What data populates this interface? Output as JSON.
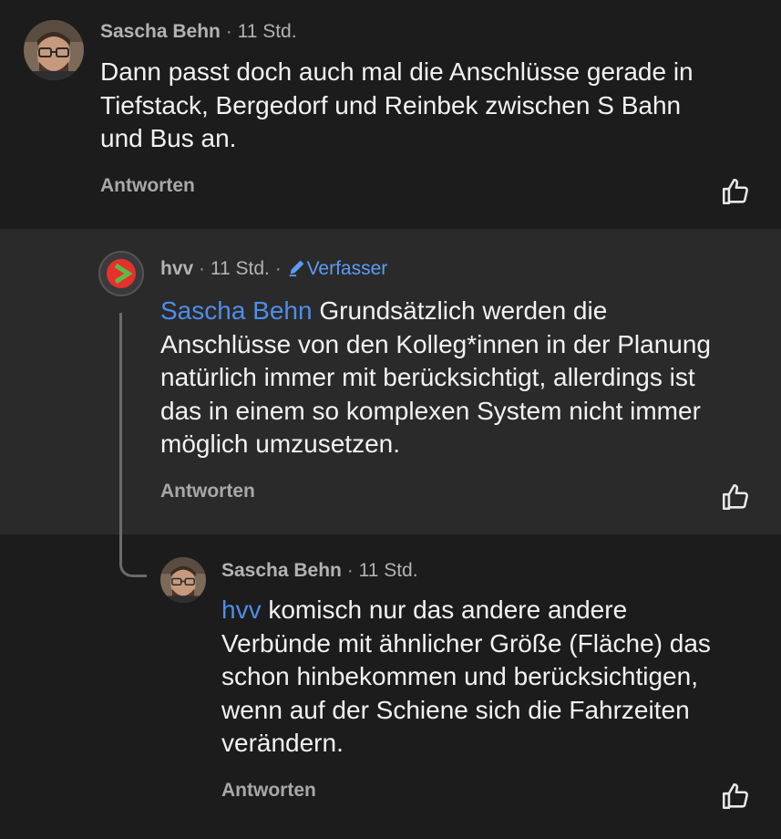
{
  "comments": [
    {
      "author": "Sascha Behn",
      "time": "11 Std.",
      "lines": [
        "Dann passt doch auch mal die Anschlüsse gerade in",
        "Tiefstack, Bergedorf und Reinbek zwischen S Bahn",
        "und Bus an."
      ],
      "reply_label": "Antworten",
      "like_icon": "thumbs-up-icon"
    },
    {
      "author": "hvv",
      "time": "11 Std.",
      "badge_label": "Verfasser",
      "badge_icon": "pencil-icon",
      "mention": "Sascha Behn",
      "lines": [
        " Grundsätzlich werden die",
        "Anschlüsse von den Kolleg*innen in der Planung",
        "natürlich immer mit berücksichtigt, allerdings ist",
        "das in einem so komplexen System nicht immer",
        "möglich umzusetzen."
      ],
      "reply_label": "Antworten",
      "like_icon": "thumbs-up-icon"
    },
    {
      "author": "Sascha Behn",
      "time": "11 Std.",
      "mention": "hvv",
      "lines": [
        " komisch nur das andere andere",
        "Verbünde mit ähnlicher Größe (Fläche) das",
        "schon hinbekommen und berücksichtigen,",
        "wenn auf der Schiene sich die Fahrzeiten",
        "verändern."
      ],
      "reply_label": "Antworten",
      "like_icon": "thumbs-up-icon"
    }
  ],
  "separator": "·",
  "colors": {
    "background": "#1c1c1d",
    "highlight_background": "#2a2a2b",
    "mention": "#4f8de8",
    "author_badge": "#5b9cf3",
    "hvv_logo_red": "#e4322b",
    "hvv_logo_green": "#5dbb46"
  }
}
